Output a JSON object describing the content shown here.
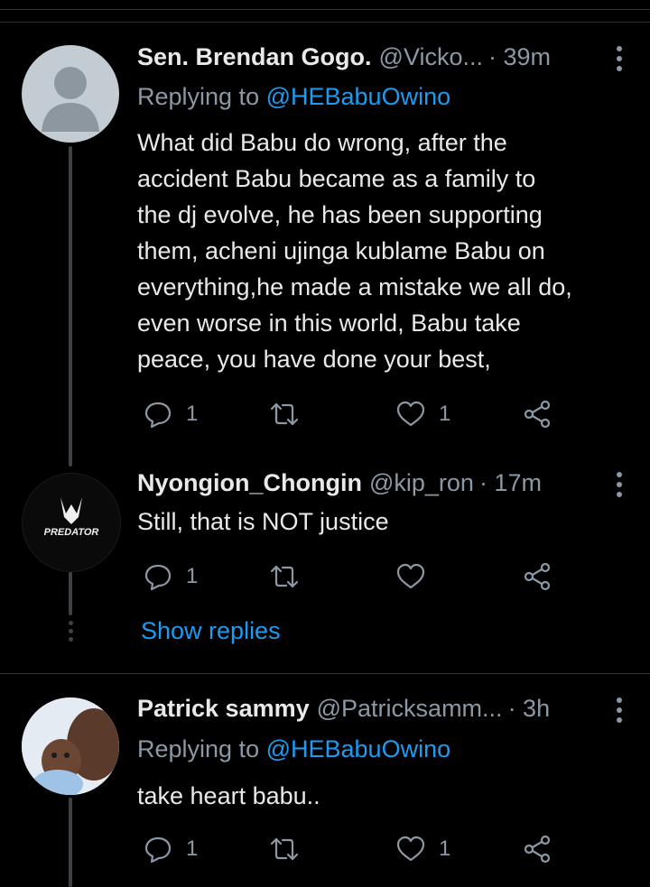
{
  "tweets": [
    {
      "name": "Sen. Brendan Gogo.",
      "handle": "@Vicko...",
      "time": " · 39m",
      "replying_prefix": "Replying to ",
      "replying_to": "@HEBabuOwino",
      "text": "What did Babu do wrong, after the\naccident Babu became as a family to\nthe dj evolve, he has been supporting\nthem, acheni ujinga kublame Babu on\neverything,he made a mistake we all do,\neven worse in this world, Babu take\npeace, you have done your best,",
      "reply_count": "1",
      "retweet_count": "",
      "like_count": "1",
      "avatar_icon": "default-user-icon"
    },
    {
      "name": "Nyongion_Chongin",
      "handle": "@kip_ron",
      "time": " · 17m",
      "text": "Still, that is NOT justice",
      "reply_count": "1",
      "retweet_count": "",
      "like_count": "",
      "avatar_logo": "PREDATOR"
    },
    {
      "name": "Patrick sammy",
      "handle": "@Patricksamm...",
      "time": " · 3h",
      "replying_prefix": "Replying to ",
      "replying_to": "@HEBabuOwino",
      "text": "take heart babu..",
      "reply_count": "1",
      "retweet_count": "",
      "like_count": "1",
      "avatar_icon": "user-photo"
    }
  ],
  "show_replies": "Show replies",
  "colors": {
    "background": "#000000",
    "accent": "#1d9bf0",
    "muted": "#8b98a5",
    "text": "#e7e9ea"
  }
}
